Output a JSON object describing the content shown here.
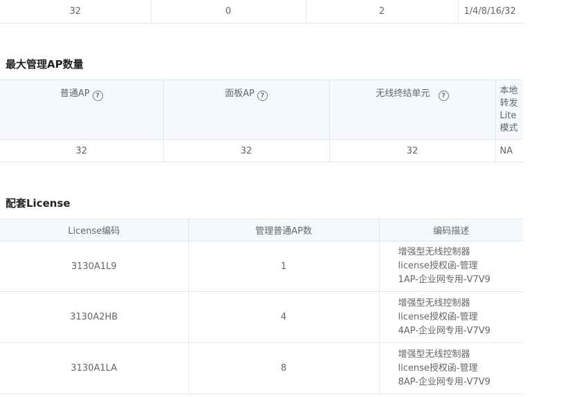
{
  "top_row": {
    "cells": [
      "32",
      "0",
      "2",
      "1/4/8/16/32"
    ]
  },
  "max_ap": {
    "title": "最大管理AP数量",
    "headers": [
      {
        "label": "普通AP",
        "help": "?"
      },
      {
        "label": "面板AP",
        "help": "?"
      },
      {
        "label": "无线终结单元",
        "help": "?"
      },
      {
        "label_lines": [
          "本地",
          "转发",
          "Lite",
          "模式"
        ]
      }
    ],
    "values": [
      "32",
      "32",
      "32",
      "NA"
    ]
  },
  "license": {
    "title": "配套License",
    "headers": [
      "License编码",
      "管理普通AP数",
      "编码描述"
    ],
    "rows": [
      {
        "code": "3130A1L9",
        "count": "1",
        "desc": [
          "增强型无线控制器",
          "license授权函-管理",
          "1AP-企业网专用-V7V9"
        ]
      },
      {
        "code": "3130A2HB",
        "count": "4",
        "desc": [
          "增强型无线控制器",
          "license授权函-管理",
          "4AP-企业网专用-V7V9"
        ]
      },
      {
        "code": "3130A1LA",
        "count": "8",
        "desc": [
          "增强型无线控制器",
          "license授权函-管理",
          "8AP-企业网专用-V7V9"
        ]
      }
    ]
  }
}
